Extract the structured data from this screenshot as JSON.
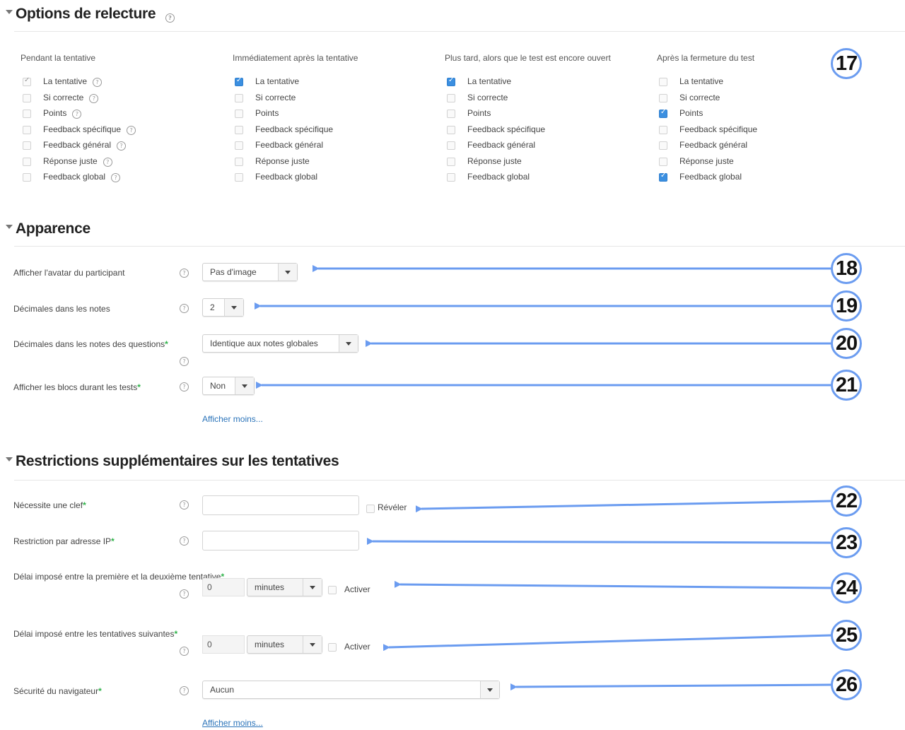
{
  "review": {
    "title": "Options de relecture",
    "columns": [
      {
        "heading": "Pendant la tentative",
        "items": [
          {
            "label": "La tentative",
            "state": "grey",
            "help": true
          },
          {
            "label": "Si correcte",
            "state": "off",
            "help": true
          },
          {
            "label": "Points",
            "state": "off",
            "help": true
          },
          {
            "label": "Feedback spécifique",
            "state": "off",
            "help": true
          },
          {
            "label": "Feedback général",
            "state": "off",
            "help": true
          },
          {
            "label": "Réponse juste",
            "state": "off",
            "help": true
          },
          {
            "label": "Feedback global",
            "state": "off",
            "help": true
          }
        ]
      },
      {
        "heading": "Immédiatement après la tentative",
        "items": [
          {
            "label": "La tentative",
            "state": "on"
          },
          {
            "label": "Si correcte",
            "state": "off"
          },
          {
            "label": "Points",
            "state": "off"
          },
          {
            "label": "Feedback spécifique",
            "state": "off"
          },
          {
            "label": "Feedback général",
            "state": "off"
          },
          {
            "label": "Réponse juste",
            "state": "off"
          },
          {
            "label": "Feedback global",
            "state": "off"
          }
        ]
      },
      {
        "heading": "Plus tard, alors que le test est encore ouvert",
        "items": [
          {
            "label": "La tentative",
            "state": "on"
          },
          {
            "label": "Si correcte",
            "state": "off"
          },
          {
            "label": "Points",
            "state": "off"
          },
          {
            "label": "Feedback spécifique",
            "state": "off"
          },
          {
            "label": "Feedback général",
            "state": "off"
          },
          {
            "label": "Réponse juste",
            "state": "off"
          },
          {
            "label": "Feedback global",
            "state": "off"
          }
        ]
      },
      {
        "heading": "Après la fermeture du test",
        "items": [
          {
            "label": "La tentative",
            "state": "off"
          },
          {
            "label": "Si correcte",
            "state": "off"
          },
          {
            "label": "Points",
            "state": "on"
          },
          {
            "label": "Feedback spécifique",
            "state": "off"
          },
          {
            "label": "Feedback général",
            "state": "off"
          },
          {
            "label": "Réponse juste",
            "state": "off"
          },
          {
            "label": "Feedback global",
            "state": "on"
          }
        ]
      }
    ]
  },
  "appearance": {
    "title": "Apparence",
    "avatar_label": "Afficher l'avatar du participant",
    "avatar_value": "Pas d'image",
    "decimals_label": "Décimales dans les notes",
    "decimals_value": "2",
    "question_decimals_label": "Décimales dans les notes des questions",
    "question_decimals_value": "Identique aux notes globales",
    "blocks_label": "Afficher les blocs durant les tests",
    "blocks_value": "Non",
    "show_less": "Afficher moins..."
  },
  "restrictions": {
    "title": "Restrictions supplémentaires sur les tentatives",
    "password_label": "Nécessite une clef",
    "reveal_label": "Révéler",
    "ip_label": "Restriction par adresse IP",
    "delay1_label": "Délai imposé entre la première et la deuxième tentative",
    "delay1_value": "0",
    "delay1_unit": "minutes",
    "delay1_enable": "Activer",
    "delay2_label": "Délai imposé entre les tentatives suivantes",
    "delay2_value": "0",
    "delay2_unit": "minutes",
    "delay2_enable": "Activer",
    "security_label": "Sécurité du navigateur",
    "security_value": "Aucun",
    "show_less": "Afficher moins..."
  },
  "badges": [
    "17",
    "18",
    "19",
    "20",
    "21",
    "22",
    "23",
    "24",
    "25",
    "26"
  ],
  "colors": {
    "accent": "#6b9cf0",
    "checkbox_on": "#3b8fe0",
    "required": "#2fb34a",
    "link": "#2a73b9"
  }
}
